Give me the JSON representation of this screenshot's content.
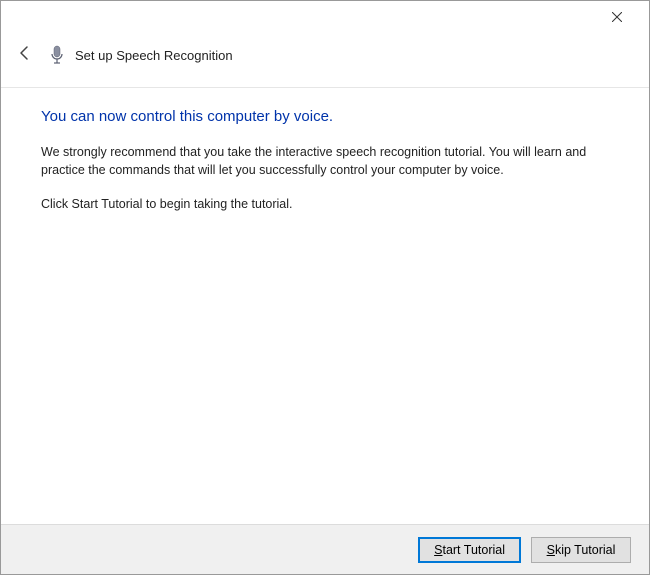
{
  "window": {
    "close_label": "✕"
  },
  "header": {
    "title": "Set up Speech Recognition"
  },
  "main": {
    "heading": "You can now control this computer by voice.",
    "paragraph1": "We strongly recommend that you take the interactive speech recognition tutorial. You will learn and practice the commands that will let you successfully control your computer by voice.",
    "paragraph2": "Click Start Tutorial to begin taking the tutorial."
  },
  "footer": {
    "start_label": "Start Tutorial",
    "skip_label": "Skip Tutorial"
  }
}
